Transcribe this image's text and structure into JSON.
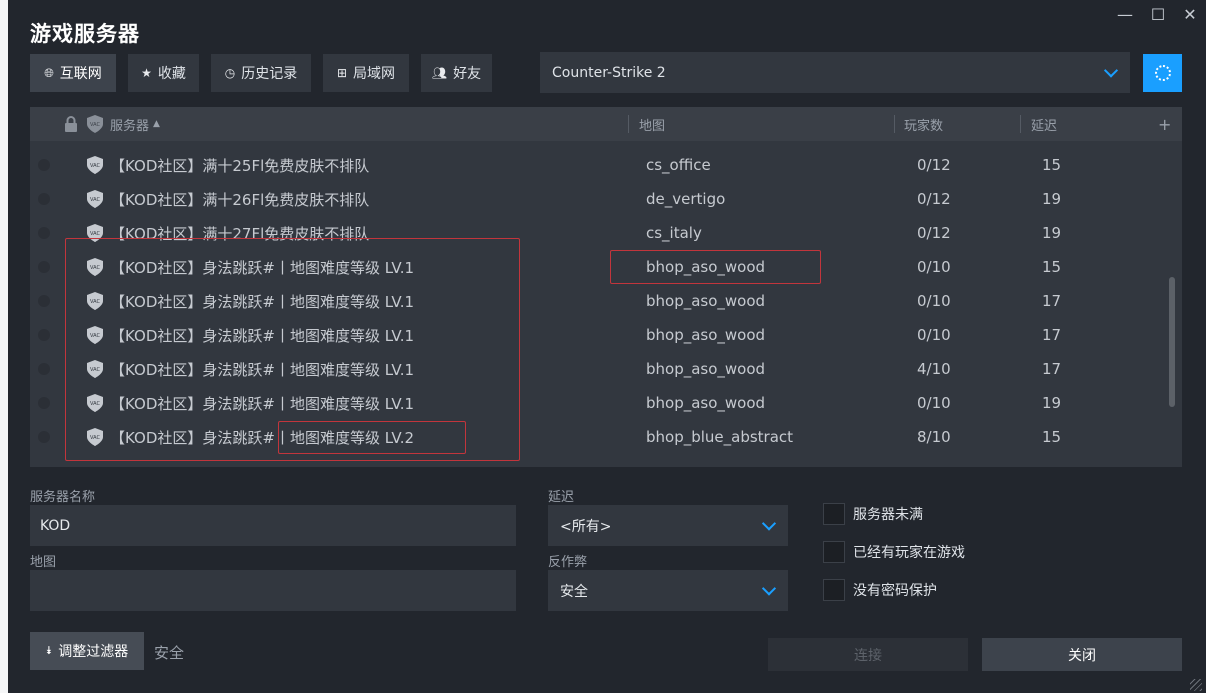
{
  "window": {
    "title": "游戏服务器",
    "controls": {
      "minimize": "—",
      "maximize": "☐",
      "close": "✕"
    }
  },
  "tabs": [
    {
      "label": "互联网",
      "icon": "globe-icon",
      "active": true
    },
    {
      "label": "收藏",
      "icon": "star-icon",
      "active": false
    },
    {
      "label": "历史记录",
      "icon": "clock-icon",
      "active": false
    },
    {
      "label": "局域网",
      "icon": "lan-icon",
      "active": false
    },
    {
      "label": "好友",
      "icon": "friends-icon",
      "active": false
    }
  ],
  "game_select": {
    "value": "Counter-Strike 2"
  },
  "columns": {
    "server": "服务器",
    "sort_indicator": "▲",
    "map": "地图",
    "players": "玩家数",
    "latency": "延迟",
    "add": "+"
  },
  "servers": [
    {
      "name": "【KOD社区】满十25Fl免费皮肤不排队",
      "map": "cs_office",
      "players": "0/12",
      "latency": "15"
    },
    {
      "name": "【KOD社区】满十26Fl免费皮肤不排队",
      "map": "de_vertigo",
      "players": "0/12",
      "latency": "19"
    },
    {
      "name": "【KOD社区】满十27Fl免费皮肤不排队",
      "map": "cs_italy",
      "players": "0/12",
      "latency": "19"
    },
    {
      "name": "【KOD社区】身法跳跃#丨地图难度等级 LV.1",
      "map": "bhop_aso_wood",
      "players": "0/10",
      "latency": "15"
    },
    {
      "name": "【KOD社区】身法跳跃#丨地图难度等级 LV.1",
      "map": "bhop_aso_wood",
      "players": "0/10",
      "latency": "17"
    },
    {
      "name": "【KOD社区】身法跳跃#丨地图难度等级 LV.1",
      "map": "bhop_aso_wood",
      "players": "0/10",
      "latency": "17"
    },
    {
      "name": "【KOD社区】身法跳跃#丨地图难度等级 LV.1",
      "map": "bhop_aso_wood",
      "players": "4/10",
      "latency": "17"
    },
    {
      "name": "【KOD社区】身法跳跃#丨地图难度等级 LV.1",
      "map": "bhop_aso_wood",
      "players": "0/10",
      "latency": "19"
    },
    {
      "name": "【KOD社区】身法跳跃#丨地图难度等级 LV.2",
      "map": "bhop_blue_abstract",
      "players": "8/10",
      "latency": "15"
    }
  ],
  "filters": {
    "server_name_label": "服务器名称",
    "server_name_value": "KOD",
    "map_label": "地图",
    "map_value": "",
    "latency_label": "延迟",
    "latency_value": "<所有>",
    "anticheat_label": "反作弊",
    "anticheat_value": "安全",
    "checkbox_not_full": "服务器未满",
    "checkbox_has_players": "已经有玩家在游戏",
    "checkbox_no_password": "没有密码保护"
  },
  "footer": {
    "adjust_filters": "调整过滤器",
    "filter_summary": "安全",
    "connect": "连接",
    "close": "关闭"
  },
  "colors": {
    "accent": "#1a9fff",
    "background": "#22262d",
    "panel": "#32373f",
    "highlight_box": "#c2353c"
  }
}
